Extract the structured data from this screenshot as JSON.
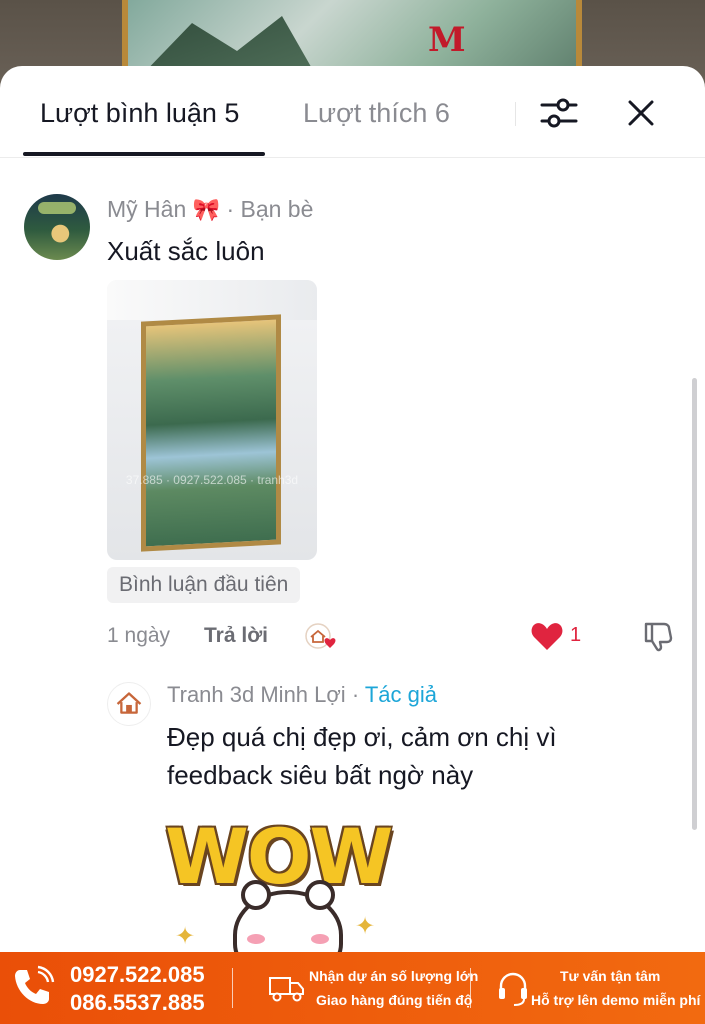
{
  "header": {
    "tab_comments": "Lượt bình luận 5",
    "tab_likes": "Lượt thích 6"
  },
  "comment": {
    "author": "Mỹ Hân",
    "author_emoji": "🎀",
    "relation": "· Bạn bè",
    "text": "Xuất sắc luôn",
    "photo_watermark": "37.885 · 0927.522.085 · tranh3d",
    "first_badge": "Bình luận đầu tiên",
    "date": "1 ngày",
    "reply_label": "Trả lời",
    "like_count": "1"
  },
  "reply": {
    "author": "Tranh 3d Minh Lợi",
    "separator": " · ",
    "author_badge": "Tác giả",
    "text": "Đẹp quá chị đẹp ơi, cảm ơn chị vì feedback siêu bất ngờ này",
    "sticker_text": "WOW"
  },
  "footer": {
    "phone_1": "0927.522.085",
    "phone_2": "086.5537.885",
    "shipping_line_1": "Nhận dự án số lượng lớn",
    "shipping_line_2": "Giao hàng đúng tiến độ",
    "support_line_1": "Tư vấn tận tâm",
    "support_line_2": "Hỗ trợ lên demo miễn phí"
  },
  "colors": {
    "accent_like": "#e0243f",
    "author_badge": "#1da6d8",
    "footer_bg": "#ea4f08"
  },
  "icons": [
    "filter-icon",
    "close-icon",
    "heart-icon",
    "dislike-icon",
    "phone-icon",
    "truck-icon",
    "headset-icon"
  ]
}
